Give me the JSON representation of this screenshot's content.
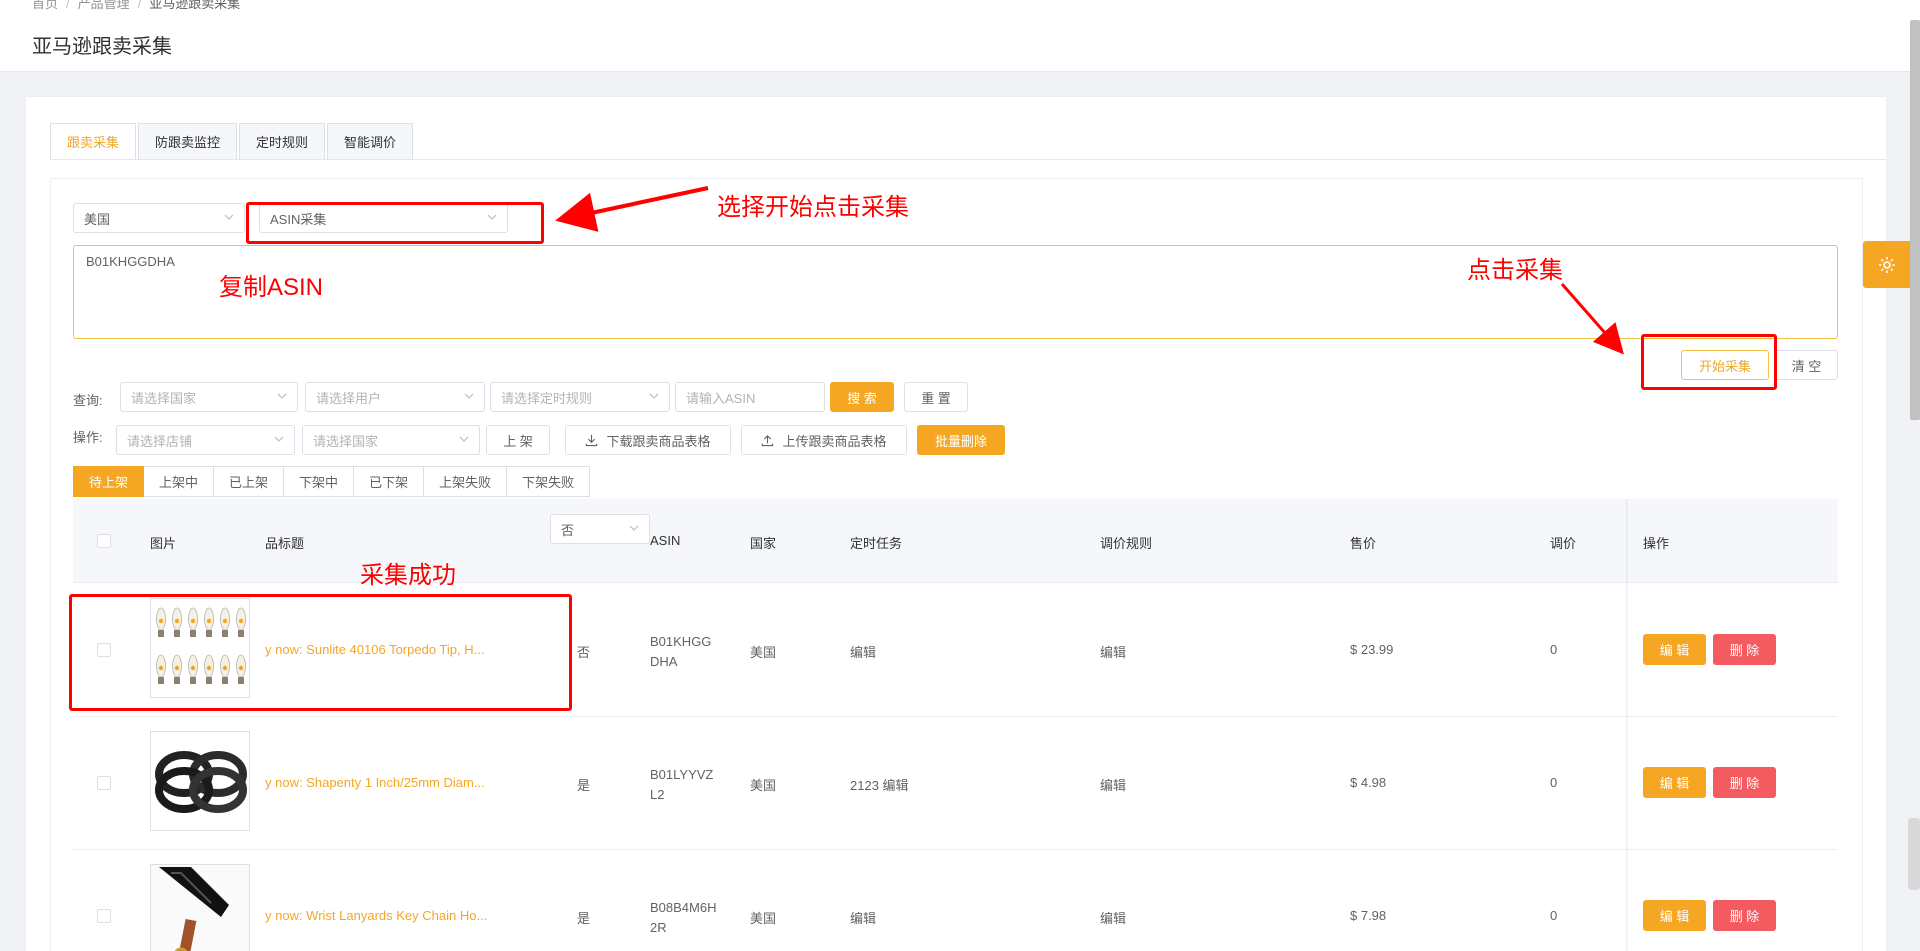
{
  "breadcrumb": [
    "首页",
    "产品管理",
    "亚马逊跟卖采集"
  ],
  "page_title": "亚马逊跟卖采集",
  "tabs": [
    "跟卖采集",
    "防跟卖监控",
    "定时规则",
    "智能调价"
  ],
  "collect": {
    "country": "美国",
    "mode": "ASIN采集",
    "asin_input": "B01KHGGDHA",
    "start_label": "开始采集",
    "clear_label": "清 空"
  },
  "query": {
    "label": "查询:",
    "country_ph": "请选择国家",
    "user_ph": "请选择用户",
    "rule_ph": "请选择定时规则",
    "asin_ph": "请输入ASIN",
    "search_label": "搜 索",
    "reset_label": "重 置"
  },
  "ops": {
    "label": "操作:",
    "store_ph": "请选择店铺",
    "country_ph": "请选择国家",
    "shelve_label": "上 架",
    "download_label": "下载跟卖商品表格",
    "upload_label": "上传跟卖商品表格",
    "batch_delete_label": "批量删除"
  },
  "status_tabs": [
    "待上架",
    "上架中",
    "已上架",
    "下架中",
    "已下架",
    "上架失败",
    "下架失败"
  ],
  "table": {
    "headers": {
      "image": "图片",
      "title": "品标题",
      "filter": "否",
      "asin": "ASIN",
      "country": "国家",
      "timer": "定时任务",
      "rule": "调价规则",
      "price": "售价",
      "adjust": "调价",
      "actions": "操作"
    },
    "rows": [
      {
        "title": "y now: Sunlite 40106 Torpedo Tip, H...",
        "flag": "否",
        "asin": "B01KHGGDHA",
        "country": "美国",
        "timer": "编辑",
        "rule": "编辑",
        "price": "$ 23.99",
        "adjust": "0"
      },
      {
        "title": "y now: Shapenty 1 Inch/25mm Diam...",
        "flag": "是",
        "asin": "B01LYYVZL2",
        "country": "美国",
        "timer": "2123 编辑",
        "rule": "编辑",
        "price": "$ 4.98",
        "adjust": "0"
      },
      {
        "title": "y now: Wrist Lanyards Key Chain Ho...",
        "flag": "是",
        "asin": "B08B4M6H2R",
        "country": "美国",
        "timer": "编辑",
        "rule": "编辑",
        "price": "$ 7.98",
        "adjust": "0"
      }
    ],
    "edit_label": "编 辑",
    "delete_label": "删 除"
  },
  "annotations": {
    "select_hint": "选择开始点击采集",
    "copy_hint": "复制ASIN",
    "click_hint": "点击采集",
    "success_hint": "采集成功"
  },
  "colors": {
    "accent": "#f5a623",
    "danger": "#f35b61",
    "annotation": "#ff0000"
  }
}
